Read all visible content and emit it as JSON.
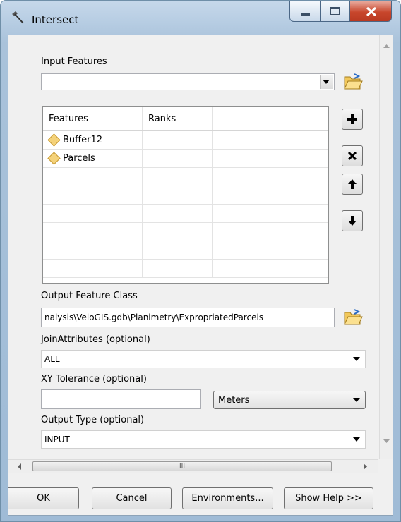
{
  "window": {
    "title": "Intersect"
  },
  "input_features": {
    "label": "Input Features",
    "value": ""
  },
  "features_table": {
    "columns": [
      "Features",
      "Ranks",
      ""
    ],
    "rows": [
      {
        "feature": "Buffer12",
        "rank": ""
      },
      {
        "feature": "Parcels",
        "rank": ""
      }
    ]
  },
  "output_feature_class": {
    "label": "Output Feature Class",
    "value": "nalysis\\VeloGIS.gdb\\Planimetry\\ExpropriatedParcels"
  },
  "join_attributes": {
    "label": "JoinAttributes (optional)",
    "value": "ALL"
  },
  "xy_tolerance": {
    "label": "XY Tolerance (optional)",
    "value": "",
    "unit": "Meters"
  },
  "output_type": {
    "label": "Output Type (optional)",
    "value": "INPUT"
  },
  "hscroll": {
    "grip": "III"
  },
  "buttons": {
    "ok": "OK",
    "cancel": "Cancel",
    "environments": "Environments...",
    "show_help": "Show Help >>"
  },
  "icons": {
    "tool": "hammer-icon",
    "add": "plus-icon",
    "remove": "x-icon",
    "up": "arrow-up-icon",
    "down": "arrow-down-icon",
    "browse": "open-folder-icon"
  }
}
